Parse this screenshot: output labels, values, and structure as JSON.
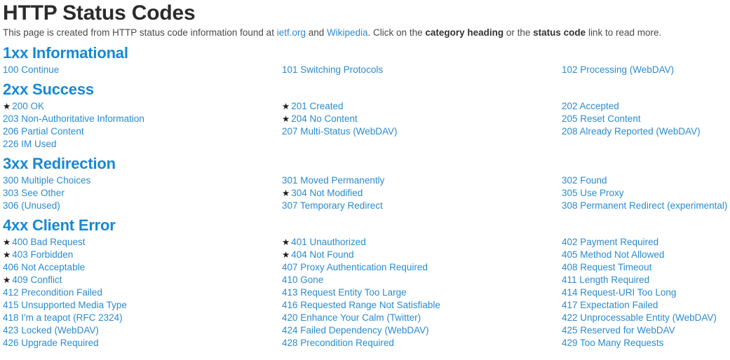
{
  "page": {
    "title": "HTTP Status Codes",
    "intro": {
      "part1": "This page is created from HTTP status code information found at ",
      "link1": "ietf.org",
      "part2": " and ",
      "link2": "Wikipedia",
      "part3": ". Click on the ",
      "bold1": "category heading",
      "part4": " or the ",
      "bold2": "status code",
      "part5": " link to read more."
    }
  },
  "colors": {
    "link": "#2a8bd0",
    "heading": "#1589d4",
    "title": "#2b2b2b",
    "star": "#1c1c1c"
  },
  "icons": {
    "star": "★"
  },
  "sections": [
    {
      "heading": "1xx Informational",
      "codes": [
        {
          "label": "100 Continue",
          "starred": false
        },
        {
          "label": "101 Switching Protocols",
          "starred": false
        },
        {
          "label": "102 Processing (WebDAV)",
          "starred": false
        }
      ]
    },
    {
      "heading": "2xx Success",
      "codes": [
        {
          "label": "200 OK",
          "starred": true
        },
        {
          "label": "201 Created",
          "starred": true
        },
        {
          "label": "202 Accepted",
          "starred": false
        },
        {
          "label": "203 Non-Authoritative Information",
          "starred": false
        },
        {
          "label": "204 No Content",
          "starred": true
        },
        {
          "label": "205 Reset Content",
          "starred": false
        },
        {
          "label": "206 Partial Content",
          "starred": false
        },
        {
          "label": "207 Multi-Status (WebDAV)",
          "starred": false
        },
        {
          "label": "208 Already Reported (WebDAV)",
          "starred": false
        },
        {
          "label": "226 IM Used",
          "starred": false
        }
      ]
    },
    {
      "heading": "3xx Redirection",
      "codes": [
        {
          "label": "300 Multiple Choices",
          "starred": false
        },
        {
          "label": "301 Moved Permanently",
          "starred": false
        },
        {
          "label": "302 Found",
          "starred": false
        },
        {
          "label": "303 See Other",
          "starred": false
        },
        {
          "label": "304 Not Modified",
          "starred": true
        },
        {
          "label": "305 Use Proxy",
          "starred": false
        },
        {
          "label": "306 (Unused)",
          "starred": false
        },
        {
          "label": "307 Temporary Redirect",
          "starred": false
        },
        {
          "label": "308 Permanent Redirect (experimental)",
          "starred": false
        }
      ]
    },
    {
      "heading": "4xx Client Error",
      "codes": [
        {
          "label": "400 Bad Request",
          "starred": true
        },
        {
          "label": "401 Unauthorized",
          "starred": true
        },
        {
          "label": "402 Payment Required",
          "starred": false
        },
        {
          "label": "403 Forbidden",
          "starred": true
        },
        {
          "label": "404 Not Found",
          "starred": true
        },
        {
          "label": "405 Method Not Allowed",
          "starred": false
        },
        {
          "label": "406 Not Acceptable",
          "starred": false
        },
        {
          "label": "407 Proxy Authentication Required",
          "starred": false
        },
        {
          "label": "408 Request Timeout",
          "starred": false
        },
        {
          "label": "409 Conflict",
          "starred": true
        },
        {
          "label": "410 Gone",
          "starred": false
        },
        {
          "label": "411 Length Required",
          "starred": false
        },
        {
          "label": "412 Precondition Failed",
          "starred": false
        },
        {
          "label": "413 Request Entity Too Large",
          "starred": false
        },
        {
          "label": "414 Request-URI Too Long",
          "starred": false
        },
        {
          "label": "415 Unsupported Media Type",
          "starred": false
        },
        {
          "label": "416 Requested Range Not Satisfiable",
          "starred": false
        },
        {
          "label": "417 Expectation Failed",
          "starred": false
        },
        {
          "label": "418 I'm a teapot (RFC 2324)",
          "starred": false
        },
        {
          "label": "420 Enhance Your Calm (Twitter)",
          "starred": false
        },
        {
          "label": "422 Unprocessable Entity (WebDAV)",
          "starred": false
        },
        {
          "label": "423 Locked (WebDAV)",
          "starred": false
        },
        {
          "label": "424 Failed Dependency (WebDAV)",
          "starred": false
        },
        {
          "label": "425 Reserved for WebDAV",
          "starred": false
        },
        {
          "label": "426 Upgrade Required",
          "starred": false
        },
        {
          "label": "428 Precondition Required",
          "starred": false
        },
        {
          "label": "429 Too Many Requests",
          "starred": false
        }
      ]
    }
  ]
}
